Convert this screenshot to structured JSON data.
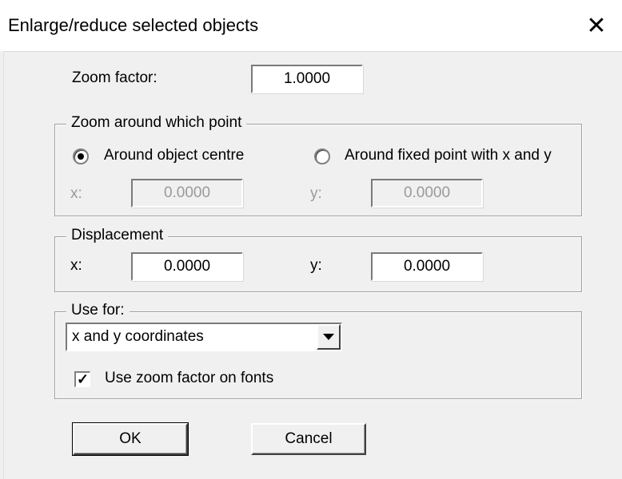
{
  "window": {
    "title": "Enlarge/reduce selected objects",
    "close_icon": "close-icon"
  },
  "zoom_factor": {
    "label": "Zoom factor:",
    "value": "1.0000"
  },
  "zoom_point": {
    "legend": "Zoom around which point",
    "option_centre": "Around object centre",
    "option_fixed": "Around fixed point with x and y",
    "selected": "centre",
    "x_label": "x:",
    "x_value": "0.0000",
    "y_label": "y:",
    "y_value": "0.0000"
  },
  "displacement": {
    "legend": "Displacement",
    "x_label": "x:",
    "x_value": "0.0000",
    "y_label": "y:",
    "y_value": "0.0000"
  },
  "use_for": {
    "legend": "Use for:",
    "selected": "x and y coordinates",
    "checkbox_label": "Use zoom factor on fonts",
    "checkbox_checked": true
  },
  "buttons": {
    "ok": "OK",
    "cancel": "Cancel"
  }
}
